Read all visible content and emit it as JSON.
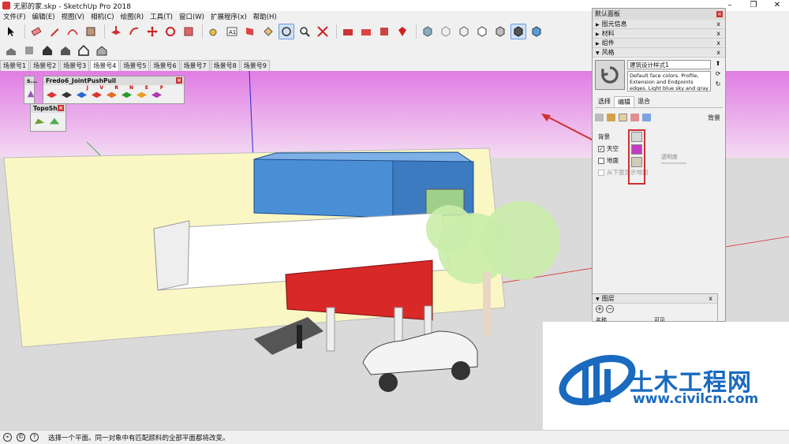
{
  "window": {
    "title": "无邪的家.skp - SketchUp Pro 2018",
    "controls": [
      "–",
      "❐",
      "✕"
    ]
  },
  "menu": [
    "文件(F)",
    "编辑(E)",
    "视图(V)",
    "相机(C)",
    "绘图(R)",
    "工具(T)",
    "窗口(W)",
    "扩展程序(x)",
    "帮助(H)"
  ],
  "scene_tabs": [
    "场景号1",
    "场景号2",
    "场景号3",
    "场景号4",
    "场景号5",
    "场景号6",
    "场景号7",
    "场景号8",
    "场景号9"
  ],
  "active_scene": "场景号4",
  "floating_toolbars": {
    "small": {
      "title": "s..."
    },
    "fredo": {
      "title": "Fredo6_JointPushPull",
      "letters": [
        "",
        "",
        "J",
        "V",
        "R",
        "N",
        "E",
        "F"
      ]
    },
    "topo": {
      "title": "TopoSh..."
    }
  },
  "tray": {
    "title": "默认面板",
    "close": "x",
    "sections": [
      {
        "label": "图元信息",
        "state": "collapsed"
      },
      {
        "label": "材料",
        "state": "collapsed"
      },
      {
        "label": "组件",
        "state": "collapsed"
      },
      {
        "label": "风格",
        "state": "expanded"
      }
    ],
    "style": {
      "name": "建筑设计样式1",
      "description": "Default face colors. Profile, Extension and Endpoints edges. Light blue sky and gray",
      "tabs": [
        "选择",
        "编辑",
        "混合"
      ],
      "active_tab": "编辑",
      "edit_section_label": "背景",
      "background_label": "背景",
      "sky_label": "天空",
      "ground_label": "地面",
      "below_ground_label": "从下面显示地面",
      "opacity_label": "透明度",
      "sky_checked": true,
      "ground_checked": false,
      "colors": {
        "background": "#d8d8d8",
        "sky": "#c43cc4",
        "ground": "#cfcdb8"
      }
    },
    "layers": {
      "label": "图层",
      "col_name": "名称",
      "col_visible": "可见",
      "col_color": "颜"
    }
  },
  "status": {
    "text": "选择一个平面。同一对象中有匹配颜料的全部平面都将改变。"
  },
  "watermark": {
    "brand": "土木工程网",
    "url": "www.civilcn.com"
  },
  "theme": {
    "sky_gradient_top": "#e17ce4",
    "sky_gradient_bottom": "#f2d4f0",
    "ground": "#d9d9d9",
    "container_blue": "#4a8fd6",
    "container_red": "#d82828",
    "accent_red": "#d03030"
  }
}
